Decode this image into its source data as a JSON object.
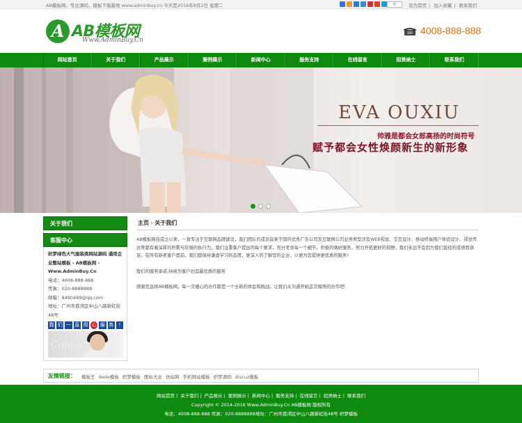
{
  "topbar": {
    "welcome": "AB模板网，专业源码、模板下载基地 www.adminbuy.cn 今天是2016年8月2日 星期二",
    "share_count": "0",
    "links": [
      "设为首页",
      "加入收藏",
      "联系我们"
    ],
    "icon_colors": [
      "#3b73c8",
      "#e89a2a",
      "#2a7bd3",
      "#2a8fdc",
      "#d03030",
      "#e04020",
      "#1a9ad6"
    ]
  },
  "header": {
    "logo_letter": "A",
    "logo_text": "AB模板网",
    "logo_sub": "Www.AdminBuy.Cn",
    "phone": "4008-888-888",
    "phone_color": "#e36c09",
    "brand_color": "#0f8a0f"
  },
  "nav": {
    "items": [
      "网站首页",
      "关于我们",
      "产品展示",
      "案例展示",
      "新闻中心",
      "服务支持",
      "在线留言",
      "招贤纳士",
      "联系我们"
    ]
  },
  "banner": {
    "brand": "EVA OUXIU",
    "slogan1": "帅雅是都会女郎高扬的时尚符号",
    "slogan2": "赋予都会女性焕颜新生的新形象",
    "slides": 3,
    "active_slide": 1
  },
  "sidebar": {
    "about_title": "关于我们",
    "service_title": "客服中心",
    "company_name": "织梦绿色大气服装类网站源码 通用企业整站模板 - AB模板网 - Www.AdminBuy.Cn",
    "phone_line": "电话：4008-888-888",
    "fax_line": "传真：020-8888888",
    "email_line": "邮箱：9490489@qq.com",
    "address_line": "地址：广州市荔湾区中山八路新虹街48号",
    "qq_chars": [
      "我",
      "们",
      "一",
      "直",
      "用",
      "心",
      "服",
      "务",
      "!"
    ],
    "contact_label": "Contact"
  },
  "main": {
    "breadcrumb_home": "主页",
    "breadcrumb_sep": "›",
    "breadcrumb_current": "关于我们",
    "paragraphs": [
      "AB模板网自成立以来，一直专注于互联网品牌建设，我们团队的成员皆来于国内优秀广告公司及互联网公司业务类型涉及WEB视觉、交互设计、移动终端用户体验设计、视觉传达等都有着深厚的积累与较强的执行力。我们注重客户提出的每个要求，充分考虑每一个细节，积极的做好服务，努力开拓更好的视野。我们永远不会因为我们曾经的成绩而满足。在所有新老客户面前，我们都保持谦虚学习的态度，更深入的了解您的企业，以便为您提供更优质的服务！",
      "我们的服务承诺:持续为客户创造最优质的服务",
      "感谢您选择AB模板网，每一次细心的合作都是一个全新的体会和挑战，让我们从沟通开始这次愉快的合作吧！"
    ]
  },
  "friends": {
    "label": "友情链接：",
    "links": [
      "模板王",
      "dede模板",
      "织梦模板",
      "图标大全",
      "仿站网",
      "手机网站模板",
      "织梦源码",
      "discuz模板"
    ]
  },
  "footer": {
    "links": [
      "网站首页",
      "关于我们",
      "产品展示",
      "案例展示",
      "新闻中心",
      "服务支持",
      "在线留言",
      "招贤纳士",
      "联系我们"
    ],
    "copyright": "Copyright © 2014-2016 Www.AdminBuy.Cn AB模板网 版权所有",
    "contact": "电话：4008-888-888 传真：020-8888888地址：广州市荔湾区中山八路新虹街48号 织梦模板"
  }
}
